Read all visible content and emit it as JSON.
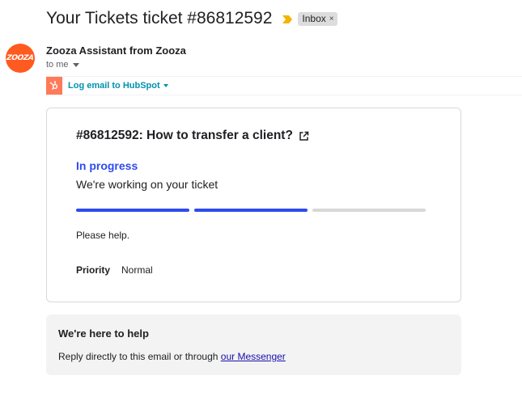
{
  "email": {
    "subject": "Your Tickets ticket #86812592",
    "label": "Inbox",
    "label_remove": "×",
    "sender": "Zooza Assistant from Zooza",
    "sender_avatar_text": "ZOOZA",
    "recipient": "to me"
  },
  "hubspot": {
    "link_label": "Log email to HubSpot"
  },
  "ticket": {
    "title": "#86812592: How to transfer a client?",
    "status": "In progress",
    "status_description": "We're working on your ticket",
    "progress": {
      "completed_steps": 2,
      "total_steps": 3
    },
    "description": "Please help.",
    "priority_label": "Priority",
    "priority_value": "Normal"
  },
  "help": {
    "title": "We're here to help",
    "text_prefix": "Reply directly to this email or through ",
    "link_text": "our Messenger"
  },
  "colors": {
    "accent_blue": "#2c4bf0",
    "hubspot_orange": "#ff7a59",
    "hubspot_teal": "#0091ae",
    "avatar_orange": "#ff5a1f",
    "progress_gray": "#d8d8d8"
  },
  "icons": {
    "important_marker": "label-important-icon",
    "external_link": "external-link-icon",
    "hubspot_logo": "hubspot-icon"
  }
}
